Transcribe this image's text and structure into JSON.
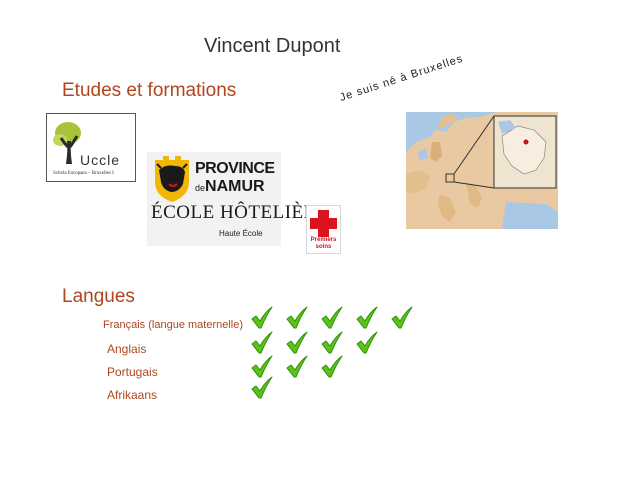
{
  "page": {
    "title": "Vincent Dupont",
    "education_heading": "Etudes et formations",
    "born_note": "Je suis né à Bruxelles",
    "languages_heading": "Langues"
  },
  "logos": {
    "uccle": {
      "name": "Uccle",
      "subtitle": "Schola Europaea – Bruxelles I"
    },
    "namur": {
      "line1": "PROVINCE",
      "line2_prefix": "de",
      "line2": "NAMUR",
      "line3": "ÉCOLE HÔTELIÈRE",
      "line4": "Haute École"
    },
    "first_aid": {
      "line1": "Premiers",
      "line2": "soins"
    }
  },
  "languages": [
    {
      "name": "Français (langue maternelle)",
      "level": 5
    },
    {
      "name": "Anglais",
      "level": 4
    },
    {
      "name": "Portugais",
      "level": 3
    },
    {
      "name": "Afrikaans",
      "level": 1
    }
  ],
  "colors": {
    "heading": "#b0461f",
    "check": "#5cc21a",
    "check_dark": "#2f8f0a",
    "cross_red": "#d9141c"
  }
}
